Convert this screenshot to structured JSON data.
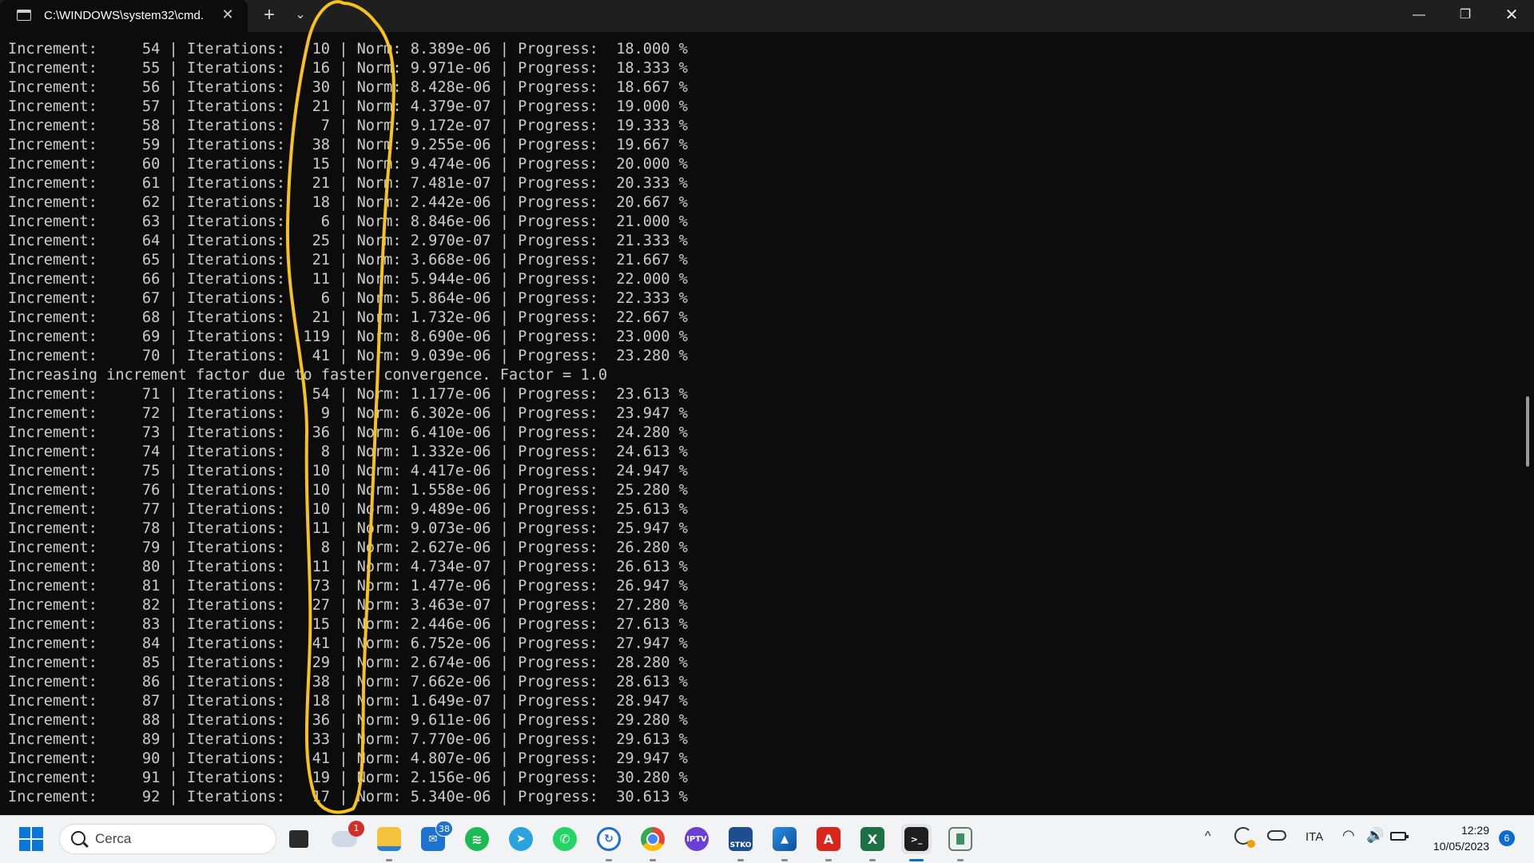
{
  "window": {
    "tab_title": "C:\\WINDOWS\\system32\\cmd.",
    "tab_close": "✕",
    "new_tab": "+",
    "dropdown": "⌄",
    "minimize": "—",
    "maximize": "❐",
    "close": "✕"
  },
  "console": {
    "lines": [
      "Increment:     54 | Iterations:   10 | Norm: 8.389e-06 | Progress:  18.000 %",
      "Increment:     55 | Iterations:   16 | Norm: 9.971e-06 | Progress:  18.333 %",
      "Increment:     56 | Iterations:   30 | Norm: 8.428e-06 | Progress:  18.667 %",
      "Increment:     57 | Iterations:   21 | Norm: 4.379e-07 | Progress:  19.000 %",
      "Increment:     58 | Iterations:    7 | Norm: 9.172e-07 | Progress:  19.333 %",
      "Increment:     59 | Iterations:   38 | Norm: 9.255e-06 | Progress:  19.667 %",
      "Increment:     60 | Iterations:   15 | Norm: 9.474e-06 | Progress:  20.000 %",
      "Increment:     61 | Iterations:   21 | Norm: 7.481e-07 | Progress:  20.333 %",
      "Increment:     62 | Iterations:   18 | Norm: 2.442e-06 | Progress:  20.667 %",
      "Increment:     63 | Iterations:    6 | Norm: 8.846e-06 | Progress:  21.000 %",
      "Increment:     64 | Iterations:   25 | Norm: 2.970e-07 | Progress:  21.333 %",
      "Increment:     65 | Iterations:   21 | Norm: 3.668e-06 | Progress:  21.667 %",
      "Increment:     66 | Iterations:   11 | Norm: 5.944e-06 | Progress:  22.000 %",
      "Increment:     67 | Iterations:    6 | Norm: 5.864e-06 | Progress:  22.333 %",
      "Increment:     68 | Iterations:   21 | Norm: 1.732e-06 | Progress:  22.667 %",
      "Increment:     69 | Iterations:  119 | Norm: 8.690e-06 | Progress:  23.000 %",
      "Increment:     70 | Iterations:   41 | Norm: 9.039e-06 | Progress:  23.280 %",
      "Increasing increment factor due to faster convergence. Factor = 1.0",
      "Increment:     71 | Iterations:   54 | Norm: 1.177e-06 | Progress:  23.613 %",
      "Increment:     72 | Iterations:    9 | Norm: 6.302e-06 | Progress:  23.947 %",
      "Increment:     73 | Iterations:   36 | Norm: 6.410e-06 | Progress:  24.280 %",
      "Increment:     74 | Iterations:    8 | Norm: 1.332e-06 | Progress:  24.613 %",
      "Increment:     75 | Iterations:   10 | Norm: 4.417e-06 | Progress:  24.947 %",
      "Increment:     76 | Iterations:   10 | Norm: 1.558e-06 | Progress:  25.280 %",
      "Increment:     77 | Iterations:   10 | Norm: 9.489e-06 | Progress:  25.613 %",
      "Increment:     78 | Iterations:   11 | Norm: 9.073e-06 | Progress:  25.947 %",
      "Increment:     79 | Iterations:    8 | Norm: 2.627e-06 | Progress:  26.280 %",
      "Increment:     80 | Iterations:   11 | Norm: 4.734e-07 | Progress:  26.613 %",
      "Increment:     81 | Iterations:   73 | Norm: 1.477e-06 | Progress:  26.947 %",
      "Increment:     82 | Iterations:   27 | Norm: 3.463e-07 | Progress:  27.280 %",
      "Increment:     83 | Iterations:   15 | Norm: 2.446e-06 | Progress:  27.613 %",
      "Increment:     84 | Iterations:   41 | Norm: 6.752e-06 | Progress:  27.947 %",
      "Increment:     85 | Iterations:   29 | Norm: 2.674e-06 | Progress:  28.280 %",
      "Increment:     86 | Iterations:   38 | Norm: 7.662e-06 | Progress:  28.613 %",
      "Increment:     87 | Iterations:   18 | Norm: 1.649e-07 | Progress:  28.947 %",
      "Increment:     88 | Iterations:   36 | Norm: 9.611e-06 | Progress:  29.280 %",
      "Increment:     89 | Iterations:   33 | Norm: 7.770e-06 | Progress:  29.613 %",
      "Increment:     90 | Iterations:   41 | Norm: 4.807e-06 | Progress:  29.947 %",
      "Increment:     91 | Iterations:   19 | Norm: 2.156e-06 | Progress:  30.280 %",
      "Increment:     92 | Iterations:   17 | Norm: 5.340e-06 | Progress:  30.613 %"
    ]
  },
  "annotation": {
    "color": "#f7c21b"
  },
  "taskbar": {
    "search_placeholder": "Cerca",
    "weather_badge": "1",
    "mail_badge": "38",
    "iptv_label": "IPTV",
    "stko_label": "STKO",
    "excel_label": "X",
    "acrobat_label": "A",
    "terminal_label": ">_",
    "tray_chevron": "^",
    "language": "ITA",
    "wifi": "◠",
    "volume": "🔊",
    "time": "12:29",
    "date": "10/05/2023",
    "notifications": "6"
  }
}
